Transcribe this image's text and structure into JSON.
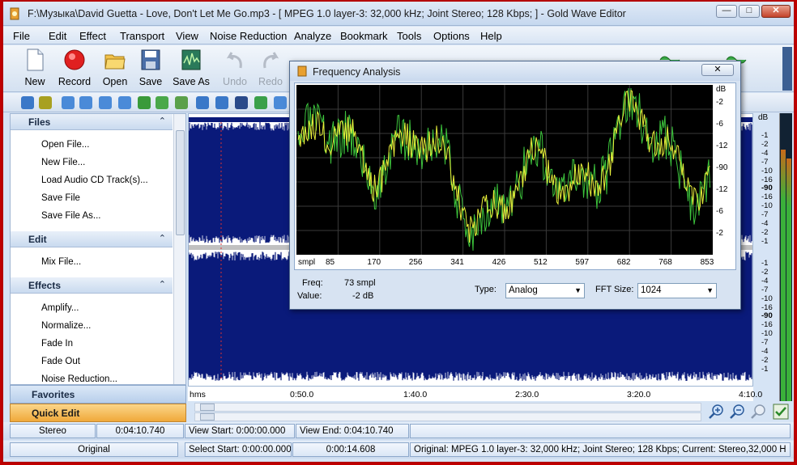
{
  "window": {
    "title": "F:\\Музыка\\David Guetta - Love, Don't Let Me Go.mp3 - [ MPEG 1.0 layer-3: 32,000 kHz; Joint Stereo; 128 Kbps;  ] - Gold Wave Editor"
  },
  "menu": [
    "File",
    "Edit",
    "Effect",
    "Transport",
    "View",
    "Noise Reduction",
    "Analyze",
    "Bookmark",
    "Tools",
    "Options",
    "Help"
  ],
  "toolbar": {
    "new": "New",
    "record": "Record",
    "open": "Open",
    "save": "Save",
    "save_as": "Save As",
    "undo": "Undo",
    "redo": "Redo"
  },
  "left_panel": {
    "files": {
      "title": "Files",
      "items": [
        "Open File...",
        "New File...",
        "Load Audio CD Track(s)...",
        "Save File",
        "Save File As..."
      ]
    },
    "edit": {
      "title": "Edit",
      "items": [
        "Mix File..."
      ]
    },
    "effects": {
      "title": "Effects",
      "items": [
        "Amplify...",
        "Normalize...",
        "Fade In",
        "Fade Out",
        "Noise Reduction..."
      ]
    },
    "favorites": "Favorites",
    "quick_edit": "Quick Edit"
  },
  "db_scale": {
    "title": "dB",
    "top_channel": [
      "-1",
      "-2",
      "-4",
      "-7",
      "-10",
      "-16",
      "-90",
      "-16",
      "-10",
      "-7",
      "-4",
      "-2",
      "-1"
    ],
    "bottom_channel": [
      "-1",
      "-2",
      "-4",
      "-7",
      "-10",
      "-16",
      "-90",
      "-16",
      "-10",
      "-7",
      "-4",
      "-2",
      "-1"
    ]
  },
  "timeline": {
    "labels": [
      "hms",
      "0:50.0",
      "1:40.0",
      "2:30.0",
      "3:20.0",
      "4:10.0"
    ]
  },
  "status": {
    "channel": "Stereo",
    "length": "0:04:10.740",
    "view_start": "View Start: 0:00:00.000",
    "view_end": "View End: 0:04:10.740",
    "mode": "Original",
    "select_start": "Select Start: 0:00:00.000",
    "select_len": "0:00:14.608",
    "format": "Original: MPEG 1.0 layer-3: 32,000 kHz; Joint Stereo; 128 Kbps;  Current: Stereo,32,000 H"
  },
  "freq_dialog": {
    "title": "Frequency Analysis",
    "x_unit": "smpl",
    "x_ticks": [
      "85",
      "170",
      "256",
      "341",
      "426",
      "512",
      "597",
      "682",
      "768",
      "853"
    ],
    "y_unit": "dB",
    "y_ticks": [
      "-2",
      "-6",
      "-12",
      "-90",
      "-12",
      "-6",
      "-2"
    ],
    "freq_label": "Freq:",
    "freq_value": "73 smpl",
    "value_label": "Value:",
    "value_value": "-2 dB",
    "type_label": "Type:",
    "type_value": "Analog",
    "fft_label": "FFT Size:",
    "fft_value": "1024"
  },
  "colors": {
    "waveform": "#0a1a7a",
    "plot_bg": "#000000",
    "plot_trace_green": "#3cc43c",
    "plot_trace_yellow": "#e8ee3a",
    "quick_edit": "#f0a93a"
  }
}
